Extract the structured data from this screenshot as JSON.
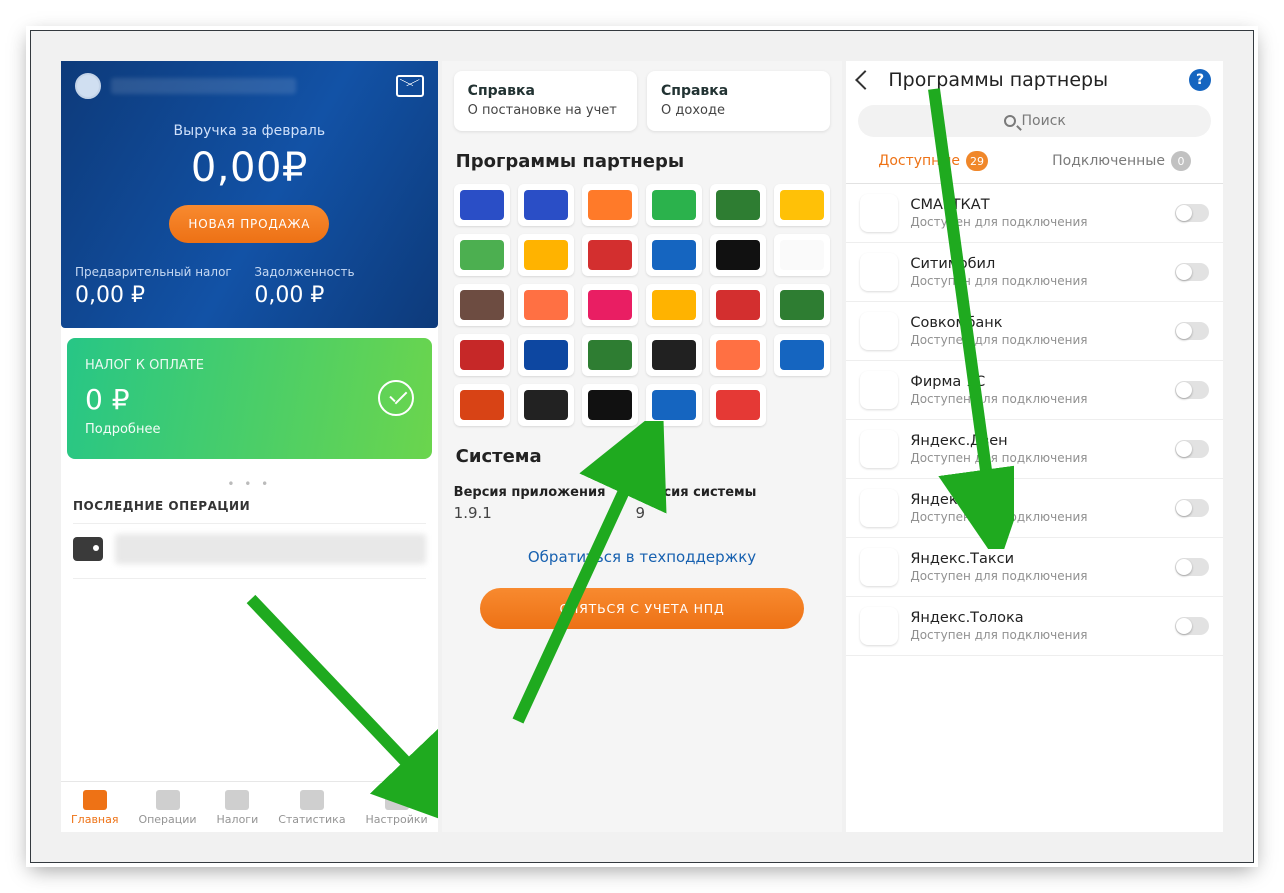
{
  "screen1": {
    "revenue_label": "Выручка за февраль",
    "revenue_value": "0,00₽",
    "new_sale_btn": "НОВАЯ ПРОДАЖА",
    "pretax_label": "Предварительный налог",
    "pretax_value": "0,00 ₽",
    "debt_label": "Задолженность",
    "debt_value": "0,00 ₽",
    "green_label": "НАЛОГ К ОПЛАТЕ",
    "green_value": "0 ₽",
    "green_more": "Подробнее",
    "ops_title": "ПОСЛЕДНИЕ ОПЕРАЦИИ",
    "nav": {
      "main": "Главная",
      "ops": "Операции",
      "tax": "Налоги",
      "stat": "Статистика",
      "settings": "Настройки"
    }
  },
  "screen2": {
    "ref1_title": "Справка",
    "ref1_sub": "О постановке на учет",
    "ref2_title": "Справка",
    "ref2_sub": "О доходе",
    "partners_title": "Программы партнеры",
    "system_title": "Система",
    "app_ver_label": "Версия приложения",
    "app_ver_value": "1.9.1",
    "sys_ver_label": "Версия системы",
    "sys_ver_value": "9",
    "support_link": "Обратиться в техподдержку",
    "remove_btn": "СНЯТЬСЯ С УЧЕТА НПД",
    "grid_colors": [
      "#2a4ec6",
      "#2a4ec6",
      "#ff7a29",
      "#2bb24c",
      "#2e7d32",
      "#ffc107",
      "#4caf50",
      "#ffb300",
      "#d32f2f",
      "#1565c0",
      "#111",
      "#fafafa",
      "#6d4c41",
      "#ff7043",
      "#e91e63",
      "#ffb300",
      "#d32f2f",
      "#2e7d32",
      "#c62828",
      "#0d47a1",
      "#2e7d32",
      "#212121",
      "#ff7043",
      "#1565c0",
      "#d84315",
      "#222",
      "#111",
      "#1565c0",
      "#e53935",
      ""
    ]
  },
  "screen3": {
    "title": "Программы партнеры",
    "search_placeholder": "Поиск",
    "tab_available": "Доступные",
    "tab_available_count": "29",
    "tab_connected": "Подключенные",
    "tab_connected_count": "0",
    "sub_common": "Доступен для подключения",
    "partners": [
      {
        "name": "СМАРТКАТ"
      },
      {
        "name": "Ситимобил"
      },
      {
        "name": "Совкомбанк"
      },
      {
        "name": "Фирма 1С"
      },
      {
        "name": "Яндекс.Дзен"
      },
      {
        "name": "Яндекс.Еда"
      },
      {
        "name": "Яндекс.Такси"
      },
      {
        "name": "Яндекс.Толока"
      }
    ]
  }
}
